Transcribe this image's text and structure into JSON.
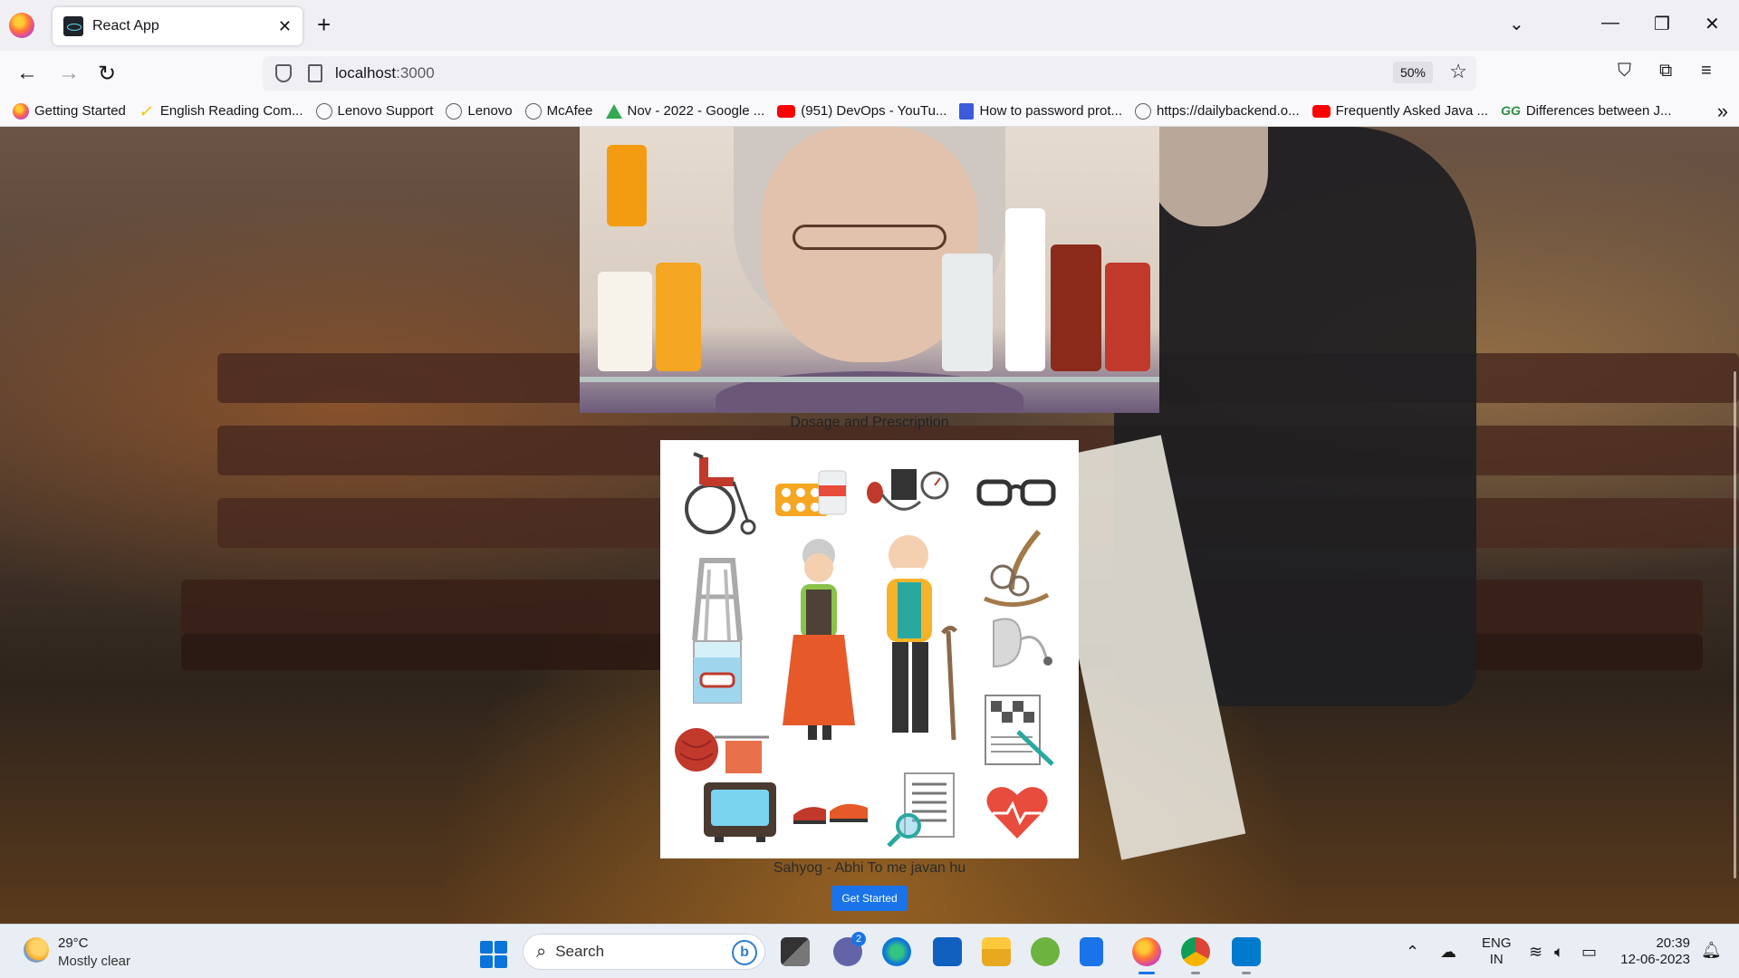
{
  "browser": {
    "tab_title": "React App",
    "url_host": "localhost",
    "url_port": ":3000",
    "zoom": "50%",
    "bookmarks": [
      {
        "label": "Getting Started",
        "icon": "firefox-icon"
      },
      {
        "label": "English Reading Com...",
        "icon": "checkmark-icon"
      },
      {
        "label": "Lenovo Support",
        "icon": "globe-icon"
      },
      {
        "label": "Lenovo",
        "icon": "globe-icon"
      },
      {
        "label": "McAfee",
        "icon": "globe-icon"
      },
      {
        "label": "Nov - 2022 - Google ...",
        "icon": "google-drive-icon"
      },
      {
        "label": "(951) DevOps - YouTu...",
        "icon": "youtube-icon"
      },
      {
        "label": "How to password prot...",
        "icon": "bookmark-l-icon"
      },
      {
        "label": "https://dailybackend.o...",
        "icon": "globe-icon"
      },
      {
        "label": "Frequently Asked Java ...",
        "icon": "youtube-icon"
      },
      {
        "label": "Differences between J...",
        "icon": "geeksforgeeks-icon"
      }
    ]
  },
  "page": {
    "section_title": "Dosage and Prescription",
    "tagline": "Sahyog - Abhi To me javan hu",
    "cta_label": "Get Started",
    "icons": [
      "wheelchair",
      "pills",
      "blood-pressure-monitor",
      "glasses",
      "rocking-chair",
      "walker",
      "elderly-woman",
      "elderly-man",
      "hearing-aid",
      "dentures-glass",
      "knitting",
      "crossword",
      "tv",
      "slippers",
      "newspaper-magnifier",
      "heart-pulse"
    ]
  },
  "taskbar": {
    "temperature": "29°C",
    "weather": "Mostly clear",
    "search_placeholder": "Search",
    "chat_badge": "2",
    "lang_top": "ENG",
    "lang_bottom": "IN",
    "time": "20:39",
    "date": "12-06-2023"
  }
}
